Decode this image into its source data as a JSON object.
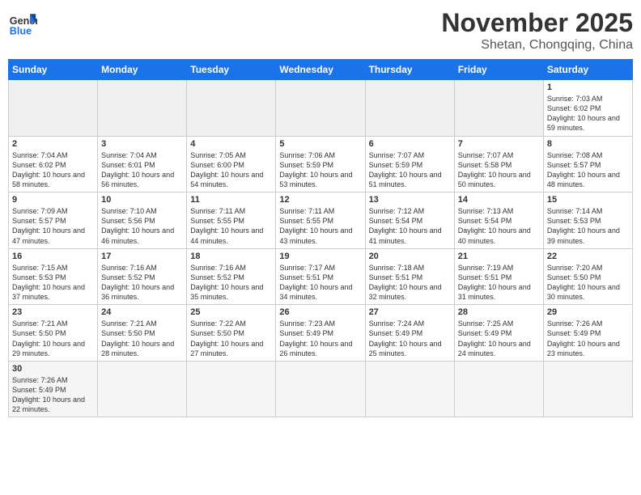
{
  "logo": {
    "text_general": "General",
    "text_blue": "Blue"
  },
  "header": {
    "month": "November 2025",
    "location": "Shetan, Chongqing, China"
  },
  "weekdays": [
    "Sunday",
    "Monday",
    "Tuesday",
    "Wednesday",
    "Thursday",
    "Friday",
    "Saturday"
  ],
  "weeks": [
    [
      {
        "day": "",
        "info": ""
      },
      {
        "day": "",
        "info": ""
      },
      {
        "day": "",
        "info": ""
      },
      {
        "day": "",
        "info": ""
      },
      {
        "day": "",
        "info": ""
      },
      {
        "day": "",
        "info": ""
      },
      {
        "day": "1",
        "info": "Sunrise: 7:03 AM\nSunset: 6:02 PM\nDaylight: 10 hours and 59 minutes."
      }
    ],
    [
      {
        "day": "2",
        "info": "Sunrise: 7:04 AM\nSunset: 6:02 PM\nDaylight: 10 hours and 58 minutes."
      },
      {
        "day": "3",
        "info": "Sunrise: 7:04 AM\nSunset: 6:01 PM\nDaylight: 10 hours and 56 minutes."
      },
      {
        "day": "4",
        "info": "Sunrise: 7:05 AM\nSunset: 6:00 PM\nDaylight: 10 hours and 54 minutes."
      },
      {
        "day": "5",
        "info": "Sunrise: 7:06 AM\nSunset: 5:59 PM\nDaylight: 10 hours and 53 minutes."
      },
      {
        "day": "6",
        "info": "Sunrise: 7:07 AM\nSunset: 5:59 PM\nDaylight: 10 hours and 51 minutes."
      },
      {
        "day": "7",
        "info": "Sunrise: 7:07 AM\nSunset: 5:58 PM\nDaylight: 10 hours and 50 minutes."
      },
      {
        "day": "8",
        "info": "Sunrise: 7:08 AM\nSunset: 5:57 PM\nDaylight: 10 hours and 48 minutes."
      }
    ],
    [
      {
        "day": "9",
        "info": "Sunrise: 7:09 AM\nSunset: 5:57 PM\nDaylight: 10 hours and 47 minutes."
      },
      {
        "day": "10",
        "info": "Sunrise: 7:10 AM\nSunset: 5:56 PM\nDaylight: 10 hours and 46 minutes."
      },
      {
        "day": "11",
        "info": "Sunrise: 7:11 AM\nSunset: 5:55 PM\nDaylight: 10 hours and 44 minutes."
      },
      {
        "day": "12",
        "info": "Sunrise: 7:11 AM\nSunset: 5:55 PM\nDaylight: 10 hours and 43 minutes."
      },
      {
        "day": "13",
        "info": "Sunrise: 7:12 AM\nSunset: 5:54 PM\nDaylight: 10 hours and 41 minutes."
      },
      {
        "day": "14",
        "info": "Sunrise: 7:13 AM\nSunset: 5:54 PM\nDaylight: 10 hours and 40 minutes."
      },
      {
        "day": "15",
        "info": "Sunrise: 7:14 AM\nSunset: 5:53 PM\nDaylight: 10 hours and 39 minutes."
      }
    ],
    [
      {
        "day": "16",
        "info": "Sunrise: 7:15 AM\nSunset: 5:53 PM\nDaylight: 10 hours and 37 minutes."
      },
      {
        "day": "17",
        "info": "Sunrise: 7:16 AM\nSunset: 5:52 PM\nDaylight: 10 hours and 36 minutes."
      },
      {
        "day": "18",
        "info": "Sunrise: 7:16 AM\nSunset: 5:52 PM\nDaylight: 10 hours and 35 minutes."
      },
      {
        "day": "19",
        "info": "Sunrise: 7:17 AM\nSunset: 5:51 PM\nDaylight: 10 hours and 34 minutes."
      },
      {
        "day": "20",
        "info": "Sunrise: 7:18 AM\nSunset: 5:51 PM\nDaylight: 10 hours and 32 minutes."
      },
      {
        "day": "21",
        "info": "Sunrise: 7:19 AM\nSunset: 5:51 PM\nDaylight: 10 hours and 31 minutes."
      },
      {
        "day": "22",
        "info": "Sunrise: 7:20 AM\nSunset: 5:50 PM\nDaylight: 10 hours and 30 minutes."
      }
    ],
    [
      {
        "day": "23",
        "info": "Sunrise: 7:21 AM\nSunset: 5:50 PM\nDaylight: 10 hours and 29 minutes."
      },
      {
        "day": "24",
        "info": "Sunrise: 7:21 AM\nSunset: 5:50 PM\nDaylight: 10 hours and 28 minutes."
      },
      {
        "day": "25",
        "info": "Sunrise: 7:22 AM\nSunset: 5:50 PM\nDaylight: 10 hours and 27 minutes."
      },
      {
        "day": "26",
        "info": "Sunrise: 7:23 AM\nSunset: 5:49 PM\nDaylight: 10 hours and 26 minutes."
      },
      {
        "day": "27",
        "info": "Sunrise: 7:24 AM\nSunset: 5:49 PM\nDaylight: 10 hours and 25 minutes."
      },
      {
        "day": "28",
        "info": "Sunrise: 7:25 AM\nSunset: 5:49 PM\nDaylight: 10 hours and 24 minutes."
      },
      {
        "day": "29",
        "info": "Sunrise: 7:26 AM\nSunset: 5:49 PM\nDaylight: 10 hours and 23 minutes."
      }
    ],
    [
      {
        "day": "30",
        "info": "Sunrise: 7:26 AM\nSunset: 5:49 PM\nDaylight: 10 hours and 22 minutes."
      },
      {
        "day": "",
        "info": ""
      },
      {
        "day": "",
        "info": ""
      },
      {
        "day": "",
        "info": ""
      },
      {
        "day": "",
        "info": ""
      },
      {
        "day": "",
        "info": ""
      },
      {
        "day": "",
        "info": ""
      }
    ]
  ]
}
